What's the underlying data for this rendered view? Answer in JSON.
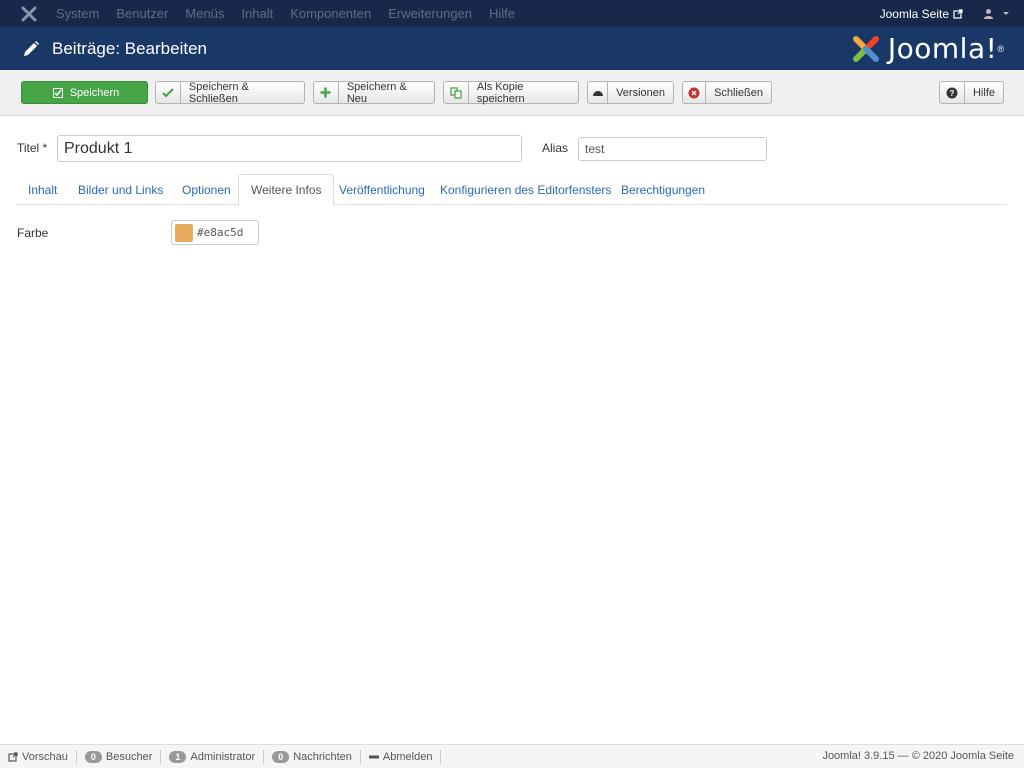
{
  "topnav": {
    "menu": [
      "System",
      "Benutzer",
      "Menüs",
      "Inhalt",
      "Komponenten",
      "Erweiterungen",
      "Hilfe"
    ],
    "site_link": "Joomla Seite"
  },
  "header": {
    "title": "Beiträge: Bearbeiten",
    "brand": "Joomla!",
    "brand_mark": "®"
  },
  "toolbar": {
    "save": "Speichern",
    "save_close": "Speichern & Schließen",
    "save_new": "Speichern & Neu",
    "save_copy": "Als Kopie speichern",
    "versions": "Versionen",
    "close": "Schließen",
    "help": "Hilfe"
  },
  "form": {
    "title_label": "Titel *",
    "title_value": "Produkt 1",
    "alias_label": "Alias",
    "alias_value": "test"
  },
  "tabs": [
    "Inhalt",
    "Bilder und Links",
    "Optionen",
    "Weitere Infos",
    "Veröffentlichung",
    "Konfigurieren des Editorfensters",
    "Berechtigungen"
  ],
  "active_tab": "Weitere Infos",
  "fields": {
    "color_label": "Farbe",
    "color_value": "#e8ac5d"
  },
  "statusbar": {
    "preview": "Vorschau",
    "visitors_count": "0",
    "visitors": "Besucher",
    "admin_count": "1",
    "admin": "Administrator",
    "messages_count": "0",
    "messages": "Nachrichten",
    "logout": "Abmelden",
    "version": "Joomla! 3.9.15",
    "sep": "—",
    "copyright": "© 2020 Joomla Seite"
  },
  "colors": {
    "topnav_bg": "#17284a",
    "header_bg": "#1a3867",
    "save_green": "#46a546",
    "link_blue": "#2a69b8",
    "swatch": "#e8ac5d"
  }
}
